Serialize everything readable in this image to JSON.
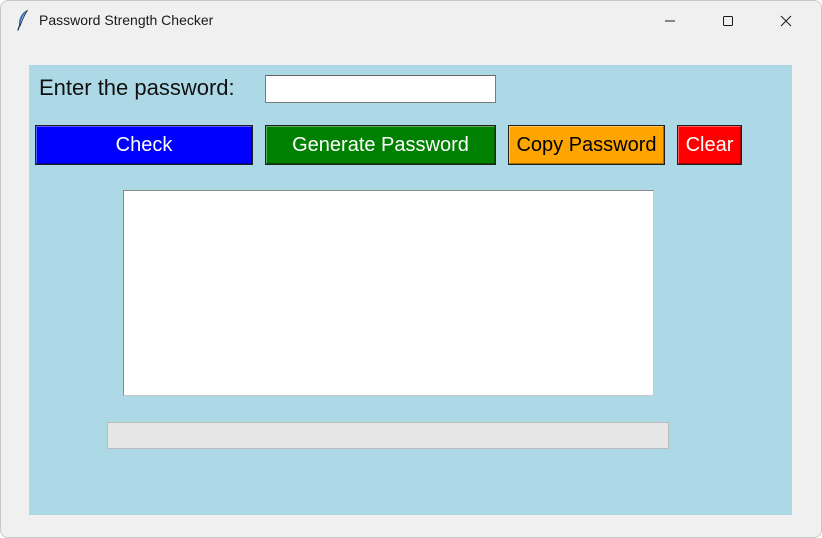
{
  "window": {
    "title": "Password Strength Checker",
    "icon": "feather-icon",
    "controls": [
      "minimize-icon",
      "maximize-icon",
      "close-icon"
    ]
  },
  "form": {
    "prompt_label": "Enter the password:",
    "password_value": "",
    "background_color": "#add8e6"
  },
  "buttons": {
    "check": {
      "label": "Check",
      "bg": "#0000ff",
      "fg": "#ffffff"
    },
    "generate": {
      "label": "Generate Password",
      "bg": "#008000",
      "fg": "#ffffff"
    },
    "copy": {
      "label": "Copy Password",
      "bg": "#ffa500",
      "fg": "#000000"
    },
    "clear": {
      "label": "Clear",
      "bg": "#ff0000",
      "fg": "#ffffff"
    }
  },
  "result": {
    "text": ""
  },
  "strength": {
    "progress": 0
  }
}
